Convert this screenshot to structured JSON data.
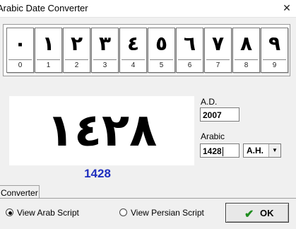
{
  "window": {
    "title": "Arabic Date Converter",
    "close_glyph": "✕"
  },
  "keypad": [
    {
      "glyph": "٠",
      "label": "0"
    },
    {
      "glyph": "١",
      "label": "1"
    },
    {
      "glyph": "٢",
      "label": "2"
    },
    {
      "glyph": "٣",
      "label": "3"
    },
    {
      "glyph": "٤",
      "label": "4"
    },
    {
      "glyph": "٥",
      "label": "5"
    },
    {
      "glyph": "٦",
      "label": "6"
    },
    {
      "glyph": "٧",
      "label": "7"
    },
    {
      "glyph": "٨",
      "label": "8"
    },
    {
      "glyph": "٩",
      "label": "9"
    }
  ],
  "display": {
    "arabic_digits": "١٤٢٨",
    "result": "1428",
    "result_color": "#1f2fbf"
  },
  "fields": {
    "ad_label": "A.D.",
    "ad_value": "2007",
    "arabic_label": "Arabic",
    "arabic_value": "1428",
    "era_value": "A.H.",
    "era_arrow_icon": "chevron-down-icon"
  },
  "tabs": [
    {
      "label": "Converter",
      "selected": true
    }
  ],
  "script_options": [
    {
      "label": "View Arab Script",
      "selected": true
    },
    {
      "label": "View Persian Script",
      "selected": false
    }
  ],
  "ok_button": {
    "label": "OK",
    "icon": "checkmark-icon",
    "icon_glyph": "✔",
    "icon_color": "#1e8c1e"
  }
}
